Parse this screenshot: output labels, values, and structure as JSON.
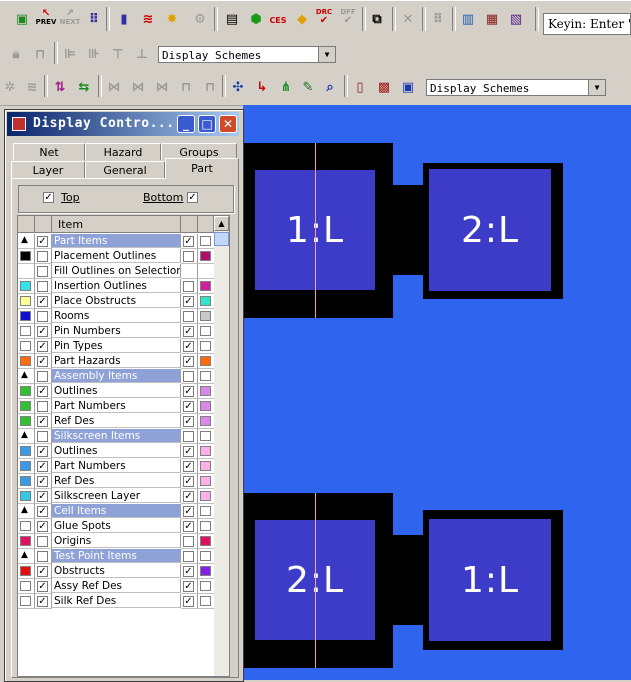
{
  "toolbar1": {
    "prev_label": "PREV",
    "next_label": "NEXT",
    "ces_label": "CES",
    "drc_label": "DRC",
    "dff_label": "DFF",
    "keyin_value": "Keyin: Enter '"
  },
  "toolbar2": {
    "scheme_value": "Display Schemes"
  },
  "toolbar3": {
    "scheme_value": "Display Schemes"
  },
  "dialog": {
    "title": "Display Contro...",
    "tabs_row1": [
      "Net",
      "Hazard",
      "Groups"
    ],
    "tabs_row2": [
      "Layer",
      "General",
      "Part"
    ],
    "active_tab": "Part",
    "top_label": "Top",
    "top_checked": true,
    "bottom_label": "Bottom",
    "bottom_checked": true,
    "column_header": "Item",
    "rows": [
      {
        "group": true,
        "exp": true,
        "sw": null,
        "c1": true,
        "label": "Part Items",
        "c3": true,
        "sw2": "#ffffff"
      },
      {
        "group": false,
        "exp": false,
        "sw": "#000000",
        "c1": false,
        "label": "Placement Outlines",
        "c3": false,
        "sw2": "#b0106a"
      },
      {
        "group": false,
        "exp": false,
        "sw": null,
        "c1": false,
        "label": "Fill Outlines on Selection",
        "c3": null,
        "sw2": null
      },
      {
        "group": false,
        "exp": false,
        "sw": "#33e3ec",
        "c1": false,
        "label": "Insertion Outlines",
        "c3": false,
        "sw2": "#d020a0"
      },
      {
        "group": false,
        "exp": false,
        "sw": "#ffff99",
        "c1": true,
        "label": "Place Obstructs",
        "c3": true,
        "sw2": "#33e3cc"
      },
      {
        "group": false,
        "exp": false,
        "sw": "#1010d0",
        "c1": false,
        "label": "Rooms",
        "c3": false,
        "sw2": "#c8c8c8"
      },
      {
        "group": false,
        "exp": false,
        "sw": "#ffffff",
        "c1": true,
        "label": "Pin Numbers",
        "c3": true,
        "sw2": "#ffffff"
      },
      {
        "group": false,
        "exp": false,
        "sw": "#ffffff",
        "c1": true,
        "label": "Pin Types",
        "c3": true,
        "sw2": "#ffffff"
      },
      {
        "group": false,
        "exp": false,
        "sw": "#ff6a10",
        "c1": true,
        "label": "Part Hazards",
        "c3": true,
        "sw2": "#ff6a10"
      },
      {
        "group": true,
        "exp": true,
        "sw": null,
        "c1": false,
        "label": "Assembly Items",
        "c3": false,
        "sw2": "#ffffff"
      },
      {
        "group": false,
        "exp": false,
        "sw": "#30c030",
        "c1": true,
        "label": "Outlines",
        "c3": true,
        "sw2": "#d888e8"
      },
      {
        "group": false,
        "exp": false,
        "sw": "#30c030",
        "c1": false,
        "label": "Part Numbers",
        "c3": true,
        "sw2": "#d888e8"
      },
      {
        "group": false,
        "exp": false,
        "sw": "#30c030",
        "c1": true,
        "label": "Ref Des",
        "c3": true,
        "sw2": "#d888e8"
      },
      {
        "group": true,
        "exp": true,
        "sw": null,
        "c1": false,
        "label": "Silkscreen Items",
        "c3": false,
        "sw2": "#ffffff"
      },
      {
        "group": false,
        "exp": false,
        "sw": "#3a9ae8",
        "c1": true,
        "label": "Outlines",
        "c3": true,
        "sw2": "#ffb0e8"
      },
      {
        "group": false,
        "exp": false,
        "sw": "#3a9ae8",
        "c1": true,
        "label": "Part Numbers",
        "c3": true,
        "sw2": "#ffb0e8"
      },
      {
        "group": false,
        "exp": false,
        "sw": "#3a9ae8",
        "c1": true,
        "label": "Ref Des",
        "c3": true,
        "sw2": "#ffb0e8"
      },
      {
        "group": false,
        "exp": false,
        "sw": "#33c8e8",
        "c1": true,
        "label": "Silkscreen Layer",
        "c3": true,
        "sw2": "#ffb0e8"
      },
      {
        "group": true,
        "exp": true,
        "sw": null,
        "c1": true,
        "label": "Cell Items",
        "c3": true,
        "sw2": "#ffffff"
      },
      {
        "group": false,
        "exp": false,
        "sw": "#ffffff",
        "c1": true,
        "label": "Glue Spots",
        "c3": true,
        "sw2": "#ffffff"
      },
      {
        "group": false,
        "exp": false,
        "sw": "#e01060",
        "c1": false,
        "label": "Origins",
        "c3": false,
        "sw2": "#e01060"
      },
      {
        "group": true,
        "exp": true,
        "sw": null,
        "c1": false,
        "label": "Test Point Items",
        "c3": false,
        "sw2": "#ffffff"
      },
      {
        "group": false,
        "exp": false,
        "sw": "#e01010",
        "c1": true,
        "label": "Obstructs",
        "c3": true,
        "sw2": "#8020e0"
      },
      {
        "group": false,
        "exp": false,
        "sw": "#ffffff",
        "c1": true,
        "label": "Assy Ref Des",
        "c3": true,
        "sw2": "#ffffff"
      },
      {
        "group": false,
        "exp": false,
        "sw": "#ffffff",
        "c1": true,
        "label": "Silk Ref Des",
        "c3": true,
        "sw2": "#ffffff"
      }
    ]
  },
  "canvas": {
    "background": "#2f64ee",
    "pad_color": "#3c3cc8",
    "pads": [
      "1:L",
      "2:L",
      "2:L",
      "1:L"
    ]
  }
}
